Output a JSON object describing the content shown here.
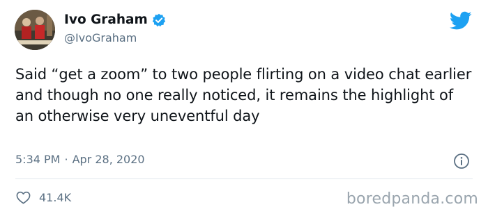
{
  "author": {
    "name": "Ivo Graham",
    "handle": "@IvoGraham"
  },
  "tweet": {
    "text": "Said “get a zoom” to two people flirting on a video chat earlier and though no one really noticed, it remains the highlight of an otherwise very uneventful day",
    "time": "5:34 PM",
    "separator": "·",
    "date": "Apr 28, 2020"
  },
  "stats": {
    "likes": "41.4K"
  },
  "watermark": "boredpanda.com",
  "colors": {
    "twitter_blue": "#1da1f2",
    "muted_text": "#5b7083"
  },
  "icons": [
    "verified-badge-icon",
    "twitter-bird-icon",
    "info-icon",
    "heart-icon"
  ]
}
